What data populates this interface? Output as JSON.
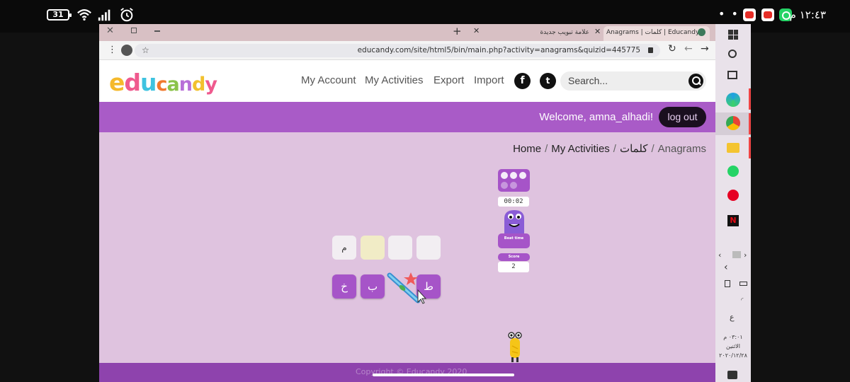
{
  "status_bar": {
    "battery": "31",
    "time": "١٢:٤٣ م",
    "more": "• • •"
  },
  "browser": {
    "tabs": [
      {
        "title": "Anagrams | كلمات | Educandy"
      },
      {
        "title": "علامة تبويب جديدة"
      }
    ],
    "url": "educandy.com/site/html5/bin/main.php?activity=anagrams&quizid=445775"
  },
  "site": {
    "logo": "educandy",
    "logo_colors": [
      "#f5b92c",
      "#ef5a8e",
      "#3ec3e0",
      "#f0792d",
      "#8bc34a",
      "#b86fd8",
      "#f2c12e",
      "#ef5a8e"
    ],
    "nav": [
      "My Account",
      "My Activities",
      "Export",
      "Import"
    ],
    "social": [
      "facebook-icon",
      "twitter-icon"
    ],
    "search_placeholder": "Search..."
  },
  "welcome": {
    "text": "Welcome, amna_alhadi!",
    "logout": "log out"
  },
  "breadcrumb": {
    "home": "Home",
    "activities": "My Activities",
    "quiz": "كلمات",
    "current": "Anagrams"
  },
  "game": {
    "answer_slots": [
      "م",
      "",
      "",
      ""
    ],
    "letters": [
      "خ",
      "ب",
      "ط"
    ],
    "timer": "00:02",
    "beat_time": "Beat time",
    "score_label": "Score",
    "score": "2"
  },
  "taskbar": {
    "date_lines": [
      "٠٣:٠١ م",
      "الاثنين",
      "٢٠٢٠/١٢/٢٨"
    ]
  },
  "footer": {
    "copyright": "Copyright © Educandy 2020"
  }
}
